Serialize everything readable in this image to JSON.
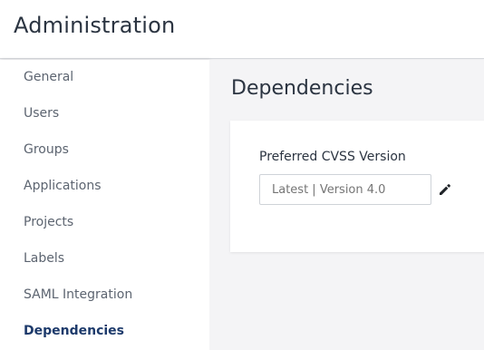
{
  "header": {
    "title": "Administration"
  },
  "sidebar": {
    "items": [
      {
        "label": "General"
      },
      {
        "label": "Users"
      },
      {
        "label": "Groups"
      },
      {
        "label": "Applications"
      },
      {
        "label": "Projects"
      },
      {
        "label": "Labels"
      },
      {
        "label": "SAML Integration"
      },
      {
        "label": "Dependencies",
        "active": true
      }
    ]
  },
  "main": {
    "title": "Dependencies",
    "card": {
      "field_label": "Preferred CVSS Version",
      "field_placeholder": "Latest | Version 4.0",
      "edit_icon": "pencil-icon"
    }
  },
  "colors": {
    "active_nav": "#1d3a6b",
    "text": "#2b3441",
    "muted": "#5c6470",
    "background": "#f4f4f6"
  }
}
